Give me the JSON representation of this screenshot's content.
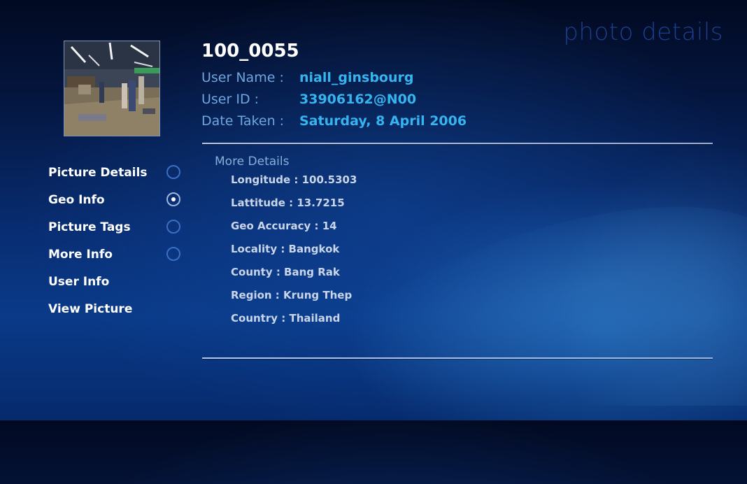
{
  "page_title": "photo details",
  "photo": {
    "name": "100_0055",
    "fields": [
      {
        "label": "User Name :",
        "value": "niall_ginsbourg"
      },
      {
        "label": "User ID :",
        "value": "33906162@N00"
      },
      {
        "label": "Date Taken :",
        "value": "Saturday, 8 April 2006"
      }
    ]
  },
  "details": {
    "title": "More Details",
    "items": [
      "Longitude : 100.5303",
      "Lattitude : 13.7215",
      "Geo Accuracy : 14",
      "Locality : Bangkok",
      "County : Bang Rak",
      "Region : Krung Thep",
      "Country : Thailand"
    ]
  },
  "nav": {
    "items": [
      {
        "label": "Picture Details",
        "radio": true,
        "selected": false
      },
      {
        "label": "Geo Info",
        "radio": true,
        "selected": true
      },
      {
        "label": "Picture Tags",
        "radio": true,
        "selected": false
      },
      {
        "label": "More Info",
        "radio": true,
        "selected": false
      },
      {
        "label": "User Info",
        "radio": false,
        "selected": false
      },
      {
        "label": "View Picture",
        "radio": false,
        "selected": false
      }
    ]
  },
  "colors": {
    "label": "#6da6e0",
    "value": "#35b4f0",
    "title": "#1d3e8e"
  }
}
